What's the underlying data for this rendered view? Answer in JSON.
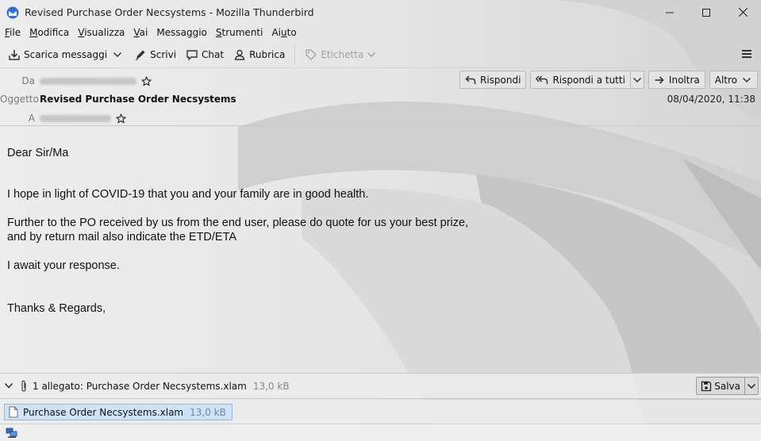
{
  "window": {
    "title": "Revised Purchase Order Necsystems - Mozilla Thunderbird"
  },
  "menu": [
    {
      "pre": "",
      "acc": "F",
      "post": "ile"
    },
    {
      "pre": "",
      "acc": "M",
      "post": "odifica"
    },
    {
      "pre": "",
      "acc": "V",
      "post": "isualizza"
    },
    {
      "pre": "",
      "acc": "V",
      "post": "ai"
    },
    {
      "pre": "Messa",
      "acc": "g",
      "post": "gio"
    },
    {
      "pre": "",
      "acc": "S",
      "post": "trumenti"
    },
    {
      "pre": "Ai",
      "acc": "u",
      "post": "to"
    }
  ],
  "toolbar": {
    "get_messages": "Scarica messaggi",
    "write": "Scrivi",
    "chat": "Chat",
    "address_book": "Rubrica",
    "tag": "Etichetta"
  },
  "header": {
    "from_label": "Da",
    "subject_label": "Oggetto",
    "to_label": "A",
    "subject": "Revised Purchase Order Necsystems",
    "date": "08/04/2020, 11:38",
    "reply": "Rispondi",
    "reply_all": "Rispondi a tutti",
    "forward": "Inoltra",
    "more": "Altro"
  },
  "body": {
    "greeting": "Dear Sir/Ma",
    "line1": "I hope in light of COVID-19 that you and your family are in good health.",
    "line2a": "Further to the PO received by us from the end user, please do quote for us your best prize,",
    "line2b": "and by return mail also indicate the ETD/ETA",
    "line3": "I await your response.",
    "closing": "Thanks & Regards,"
  },
  "attachments": {
    "summary": "1 allegato: Purchase Order Necsystems.xlam",
    "total_size": "13,0 kB",
    "save": "Salva",
    "items": [
      {
        "name": "Purchase Order Necsystems.xlam",
        "size": "13,0 kB"
      }
    ]
  },
  "colors": {
    "accent": "#cfe3f8",
    "accent_border": "#8fb8e4"
  }
}
